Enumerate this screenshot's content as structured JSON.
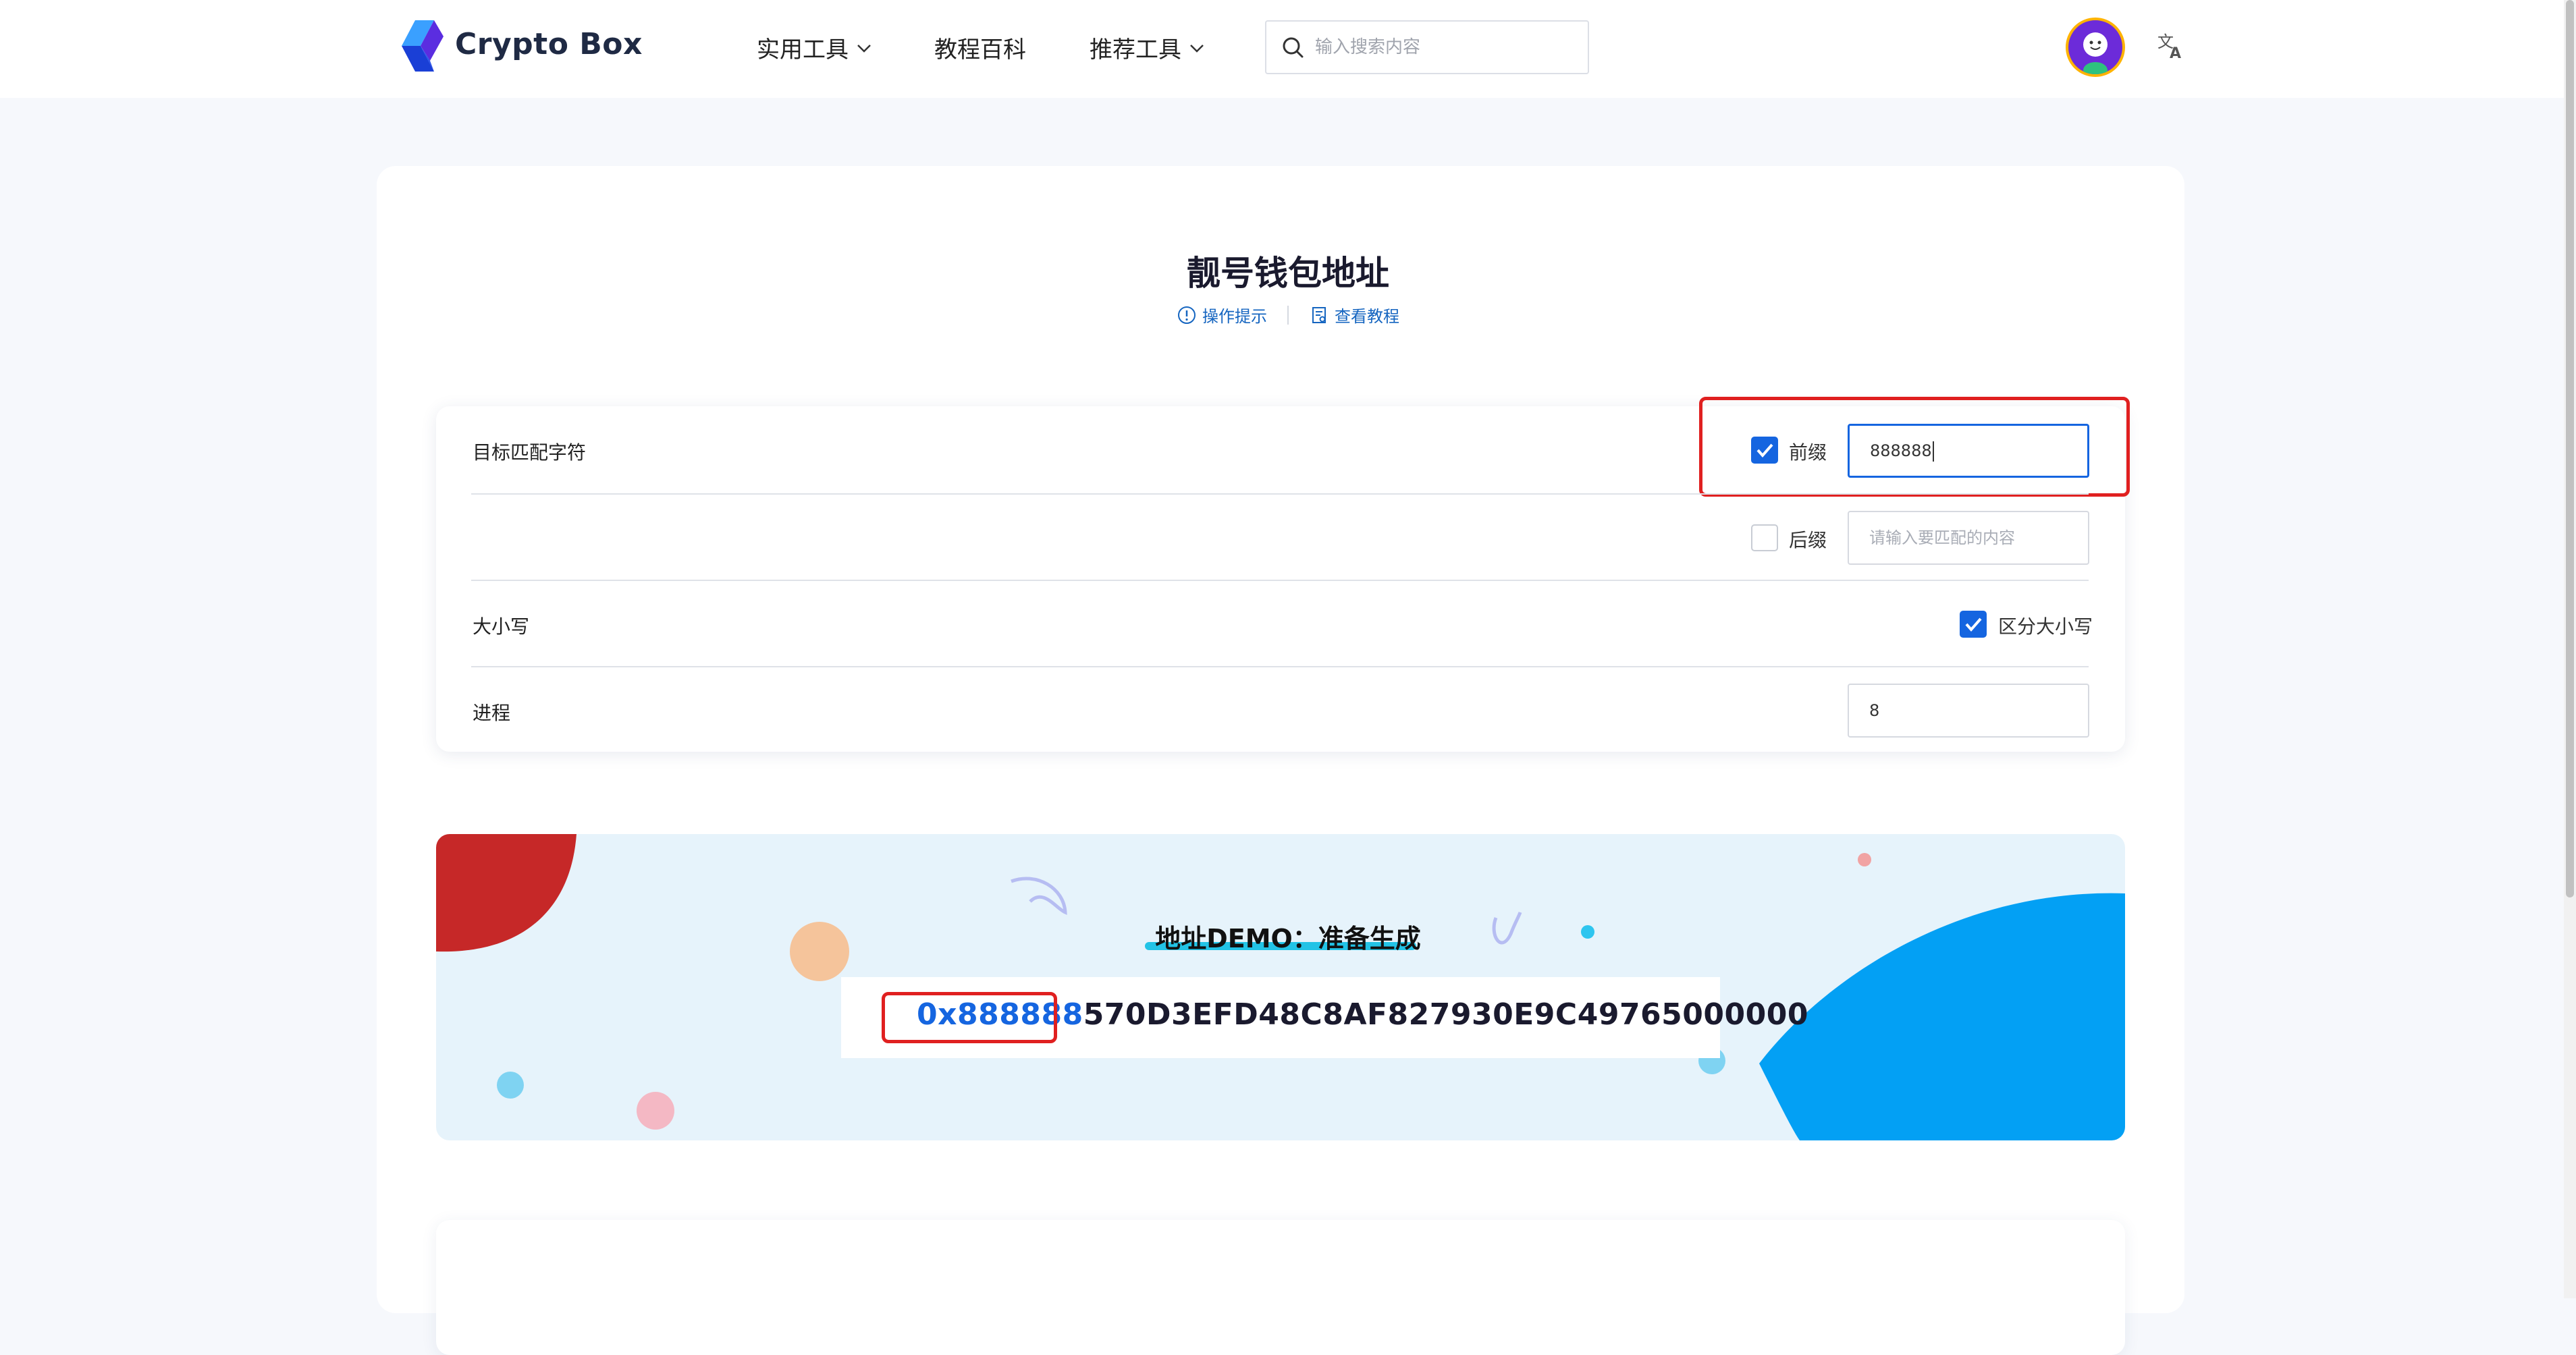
{
  "header": {
    "brand": "Crypto Box",
    "nav": [
      {
        "label": "实用工具",
        "has_dropdown": true
      },
      {
        "label": "教程百科",
        "has_dropdown": false
      },
      {
        "label": "推荐工具",
        "has_dropdown": true
      }
    ],
    "search": {
      "placeholder": "输入搜索内容",
      "value": ""
    },
    "icons": [
      "logo-icon",
      "search-icon",
      "avatar",
      "translate-icon"
    ]
  },
  "page": {
    "title": "靓号钱包地址",
    "links": [
      {
        "label": "操作提示",
        "icon": "info-icon"
      },
      {
        "label": "查看教程",
        "icon": "book-icon"
      }
    ]
  },
  "form": {
    "target_label": "目标匹配字符",
    "prefix": {
      "label": "前缀",
      "checked": true,
      "value": "888888"
    },
    "suffix": {
      "label": "后缀",
      "checked": false,
      "value": "",
      "placeholder": "请输入要匹配的内容"
    },
    "case_label": "大小写",
    "case_sensitive": {
      "label": "区分大小写",
      "checked": true
    },
    "threads_label": "进程",
    "threads_value": "8"
  },
  "demo": {
    "title": "地址DEMO：准备生成",
    "address_prefix": "0x888888",
    "address_rest": "570D3EFD48C8AF827930E9C49765000000"
  },
  "colors": {
    "accent": "#1565e0",
    "highlight": "#e02020",
    "banner_bg": "#e6f3fb",
    "page_bg": "#f6f8fc"
  }
}
